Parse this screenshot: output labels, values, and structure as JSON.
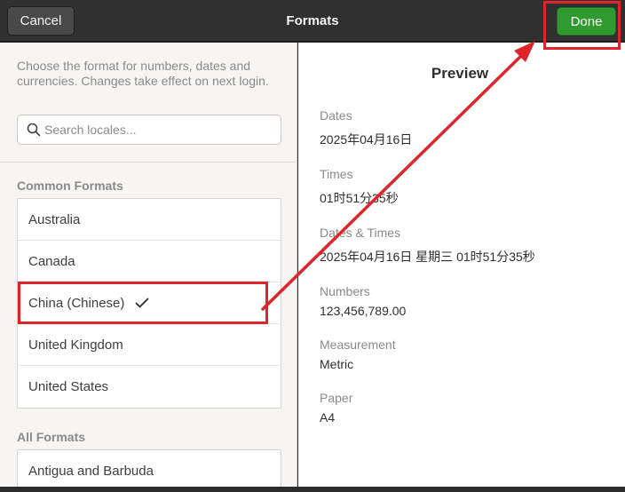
{
  "header": {
    "cancel_label": "Cancel",
    "title": "Formats",
    "done_label": "Done"
  },
  "left": {
    "description": "Choose the format for numbers, dates and currencies. Changes take effect on next login.",
    "search_placeholder": "Search locales...",
    "common_title": "Common Formats",
    "common_items": [
      "Australia",
      "Canada",
      "China (Chinese)",
      "United Kingdom",
      "United States"
    ],
    "selected_item": "China (Chinese)",
    "all_title": "All Formats",
    "all_items": [
      "Antigua and Barbuda"
    ]
  },
  "preview": {
    "title": "Preview",
    "dates_label": "Dates",
    "dates_value": "2025年04月16日",
    "times_label": "Times",
    "times_value": "01时51分35秒",
    "datetimes_label": "Dates & Times",
    "datetimes_value": "2025年04月16日 星期三 01时51分35秒",
    "numbers_label": "Numbers",
    "numbers_value": "123,456,789.00",
    "measurement_label": "Measurement",
    "measurement_value": "Metric",
    "paper_label": "Paper",
    "paper_value": "A4"
  },
  "colors": {
    "accent_done": "#2f9a2f",
    "annotation_red": "#e0242b"
  },
  "icons": [
    "search-icon",
    "check-icon"
  ]
}
